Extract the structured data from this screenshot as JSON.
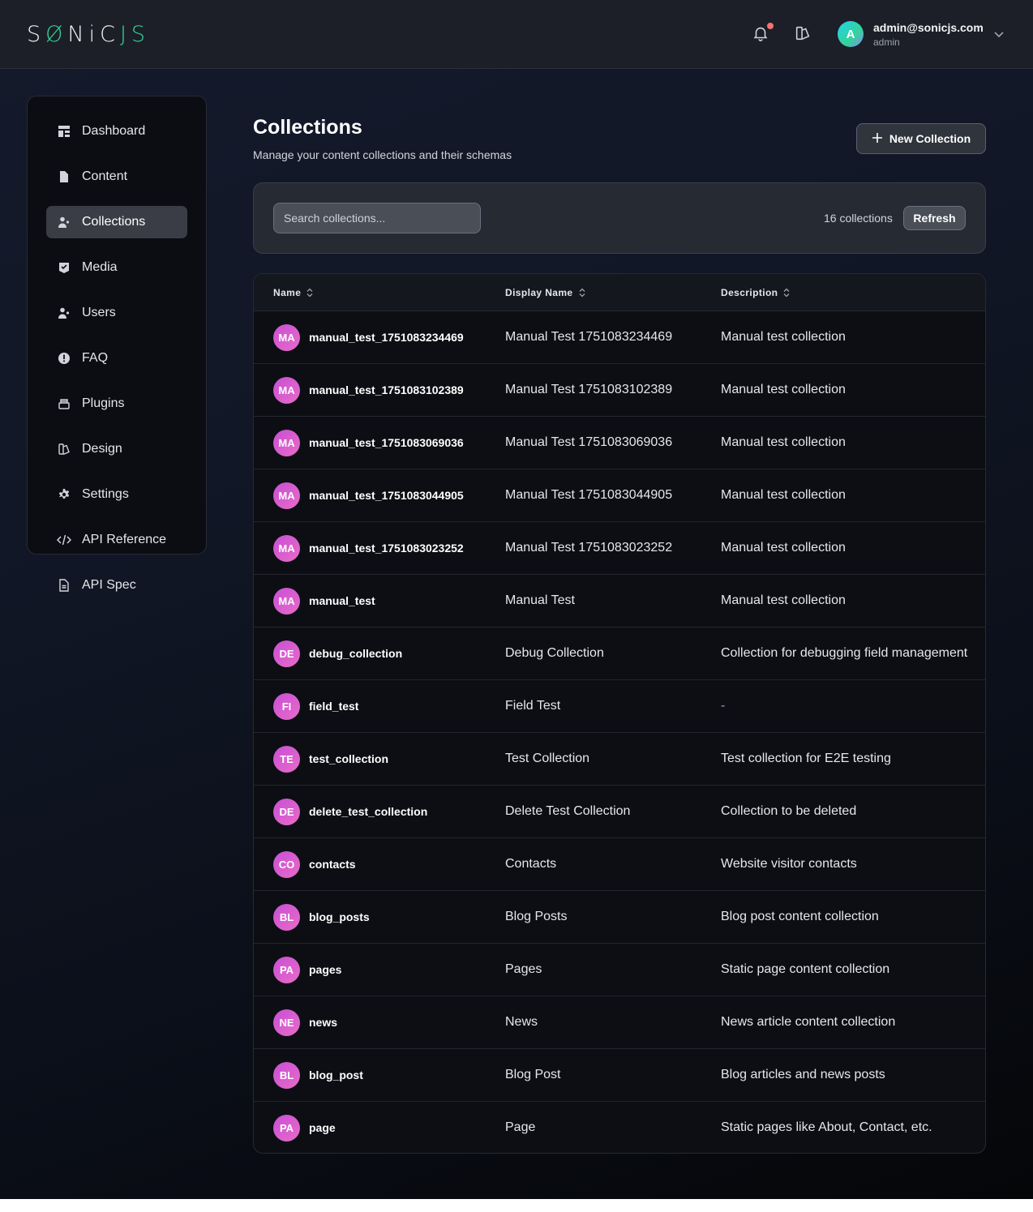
{
  "header": {
    "logo_left": "S",
    "logo_slash": "Ø",
    "logo_mid": "NiC",
    "logo_right": "JS",
    "user_initial": "A",
    "user_email": "admin@sonicjs.com",
    "user_role": "admin",
    "icons": [
      "bell-icon",
      "design-icon",
      "chevron-down-icon"
    ]
  },
  "sidebar": {
    "items": [
      {
        "label": "Dashboard",
        "icon": "dashboard-icon"
      },
      {
        "label": "Content",
        "icon": "document-icon"
      },
      {
        "label": "Collections",
        "icon": "collections-icon",
        "active": true
      },
      {
        "label": "Media",
        "icon": "media-icon"
      },
      {
        "label": "Users",
        "icon": "users-icon"
      },
      {
        "label": "FAQ",
        "icon": "faq-icon"
      },
      {
        "label": "Plugins",
        "icon": "plugins-icon"
      },
      {
        "label": "Design",
        "icon": "design-icon"
      },
      {
        "label": "Settings",
        "icon": "gear-icon"
      },
      {
        "label": "API Reference",
        "icon": "code-icon"
      },
      {
        "label": "API Spec",
        "icon": "file-text-icon"
      }
    ]
  },
  "main": {
    "title": "Collections",
    "subtitle": "Manage your content collections and their schemas",
    "new_button": "New Collection",
    "search_placeholder": "Search collections...",
    "count": "16 collections",
    "refresh": "Refresh",
    "columns": [
      "Name",
      "Display Name",
      "Description"
    ],
    "rows": [
      {
        "badge": "MA",
        "name": "manual_test_1751083234469",
        "display": "Manual Test 1751083234469",
        "description": "Manual test collection"
      },
      {
        "badge": "MA",
        "name": "manual_test_1751083102389",
        "display": "Manual Test 1751083102389",
        "description": "Manual test collection"
      },
      {
        "badge": "MA",
        "name": "manual_test_1751083069036",
        "display": "Manual Test 1751083069036",
        "description": "Manual test collection"
      },
      {
        "badge": "MA",
        "name": "manual_test_1751083044905",
        "display": "Manual Test 1751083044905",
        "description": "Manual test collection"
      },
      {
        "badge": "MA",
        "name": "manual_test_1751083023252",
        "display": "Manual Test 1751083023252",
        "description": "Manual test collection"
      },
      {
        "badge": "MA",
        "name": "manual_test",
        "display": "Manual Test",
        "description": "Manual test collection"
      },
      {
        "badge": "DE",
        "name": "debug_collection",
        "display": "Debug Collection",
        "description": "Collection for debugging field management"
      },
      {
        "badge": "FI",
        "name": "field_test",
        "display": "Field Test",
        "description": "-"
      },
      {
        "badge": "TE",
        "name": "test_collection",
        "display": "Test Collection",
        "description": "Test collection for E2E testing"
      },
      {
        "badge": "DE",
        "name": "delete_test_collection",
        "display": "Delete Test Collection",
        "description": "Collection to be deleted"
      },
      {
        "badge": "CO",
        "name": "contacts",
        "display": "Contacts",
        "description": "Website visitor contacts"
      },
      {
        "badge": "BL",
        "name": "blog_posts",
        "display": "Blog Posts",
        "description": "Blog post content collection"
      },
      {
        "badge": "PA",
        "name": "pages",
        "display": "Pages",
        "description": "Static page content collection"
      },
      {
        "badge": "NE",
        "name": "news",
        "display": "News",
        "description": "News article content collection"
      },
      {
        "badge": "BL",
        "name": "blog_post",
        "display": "Blog Post",
        "description": "Blog articles and news posts"
      },
      {
        "badge": "PA",
        "name": "page",
        "display": "Page",
        "description": "Static pages like About, Contact, etc."
      }
    ]
  },
  "colors": {
    "accent": "#34d399",
    "badge": "#d45bcf",
    "notification": "#f87171"
  }
}
